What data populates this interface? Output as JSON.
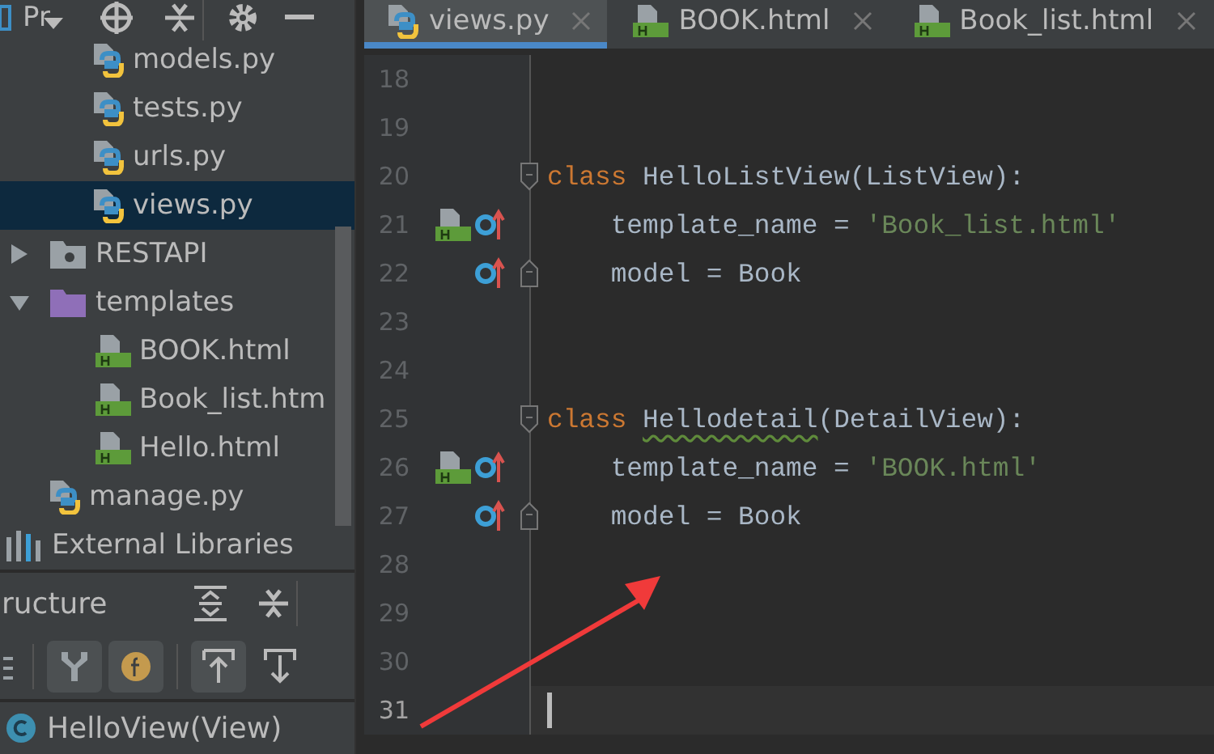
{
  "project_panel": {
    "title": "Pr",
    "tree": [
      {
        "children": [
          {
            "children": [
              {
                "label": "models.py",
                "kind": "python",
                "selected": false
              },
              {
                "label": "tests.py",
                "kind": "python",
                "selected": false
              },
              {
                "label": "urls.py",
                "kind": "python",
                "selected": false
              },
              {
                "label": "views.py",
                "kind": "python",
                "selected": true
              }
            ]
          },
          {
            "label": "RESTAPI",
            "kind": "package",
            "expanded": false,
            "selected": false
          },
          {
            "label": "templates",
            "kind": "folder",
            "expanded": true,
            "selected": false,
            "children": [
              {
                "label": "BOOK.html",
                "kind": "html",
                "selected": false
              },
              {
                "label": "Book_list.htm",
                "kind": "html",
                "selected": false
              },
              {
                "label": "Hello.html",
                "kind": "html",
                "selected": false
              }
            ]
          },
          {
            "label": "manage.py",
            "kind": "python",
            "selected": false
          }
        ]
      },
      {
        "label": "External Libraries",
        "kind": "libraries",
        "selected": false
      }
    ]
  },
  "structure_panel": {
    "title": "ructure",
    "toolbar": [
      {
        "kind": "sort",
        "on": false
      },
      {
        "kind": "inherited",
        "on": true
      },
      {
        "kind": "fields",
        "on": true
      },
      {
        "kind": "up",
        "on": true
      },
      {
        "kind": "down",
        "on": false
      }
    ],
    "items": [
      {
        "label": "HelloView(View)",
        "selected": false
      }
    ]
  },
  "editor": {
    "tabs": [
      {
        "label": "views.py",
        "kind": "python",
        "selected": true
      },
      {
        "label": "BOOK.html",
        "kind": "html",
        "selected": false
      },
      {
        "label": "Book_list.html",
        "kind": "html",
        "selected": false
      }
    ],
    "lines": [
      {
        "number": "18",
        "current": false
      },
      {
        "number": "19",
        "current": false
      },
      {
        "number": "20",
        "current": false,
        "fold_start": true,
        "tokens": [
          {
            "kind": "keyword",
            "text": "class "
          },
          {
            "kind": "class_name",
            "text": "HelloListView",
            "warning": false
          },
          {
            "kind": "plain",
            "text": "(ListView):"
          }
        ]
      },
      {
        "number": "21",
        "current": false,
        "template_link": true,
        "override": true,
        "tokens": [
          {
            "kind": "plain",
            "text": "    template_name = "
          },
          {
            "kind": "string",
            "text": "'Book_list.html'"
          }
        ]
      },
      {
        "number": "22",
        "current": false,
        "override": true,
        "fold_end": true,
        "tokens": [
          {
            "kind": "plain",
            "text": "    model = Book"
          }
        ]
      },
      {
        "number": "23",
        "current": false
      },
      {
        "number": "24",
        "current": false
      },
      {
        "number": "25",
        "current": false,
        "fold_start": true,
        "tokens": [
          {
            "kind": "keyword",
            "text": "class "
          },
          {
            "kind": "class_name",
            "text": "Hellodetail",
            "warning": true
          },
          {
            "kind": "plain",
            "text": "(DetailView):"
          }
        ]
      },
      {
        "number": "26",
        "current": false,
        "template_link": true,
        "override": true,
        "tokens": [
          {
            "kind": "plain",
            "text": "    template_name = "
          },
          {
            "kind": "string",
            "text": "'BOOK.html'"
          }
        ]
      },
      {
        "number": "27",
        "current": false,
        "override": true,
        "fold_end": true,
        "tokens": [
          {
            "kind": "plain",
            "text": "    model = Book"
          }
        ]
      },
      {
        "number": "28",
        "current": false
      },
      {
        "number": "29",
        "current": false
      },
      {
        "number": "30",
        "current": false
      },
      {
        "number": "31",
        "current": true
      }
    ]
  }
}
